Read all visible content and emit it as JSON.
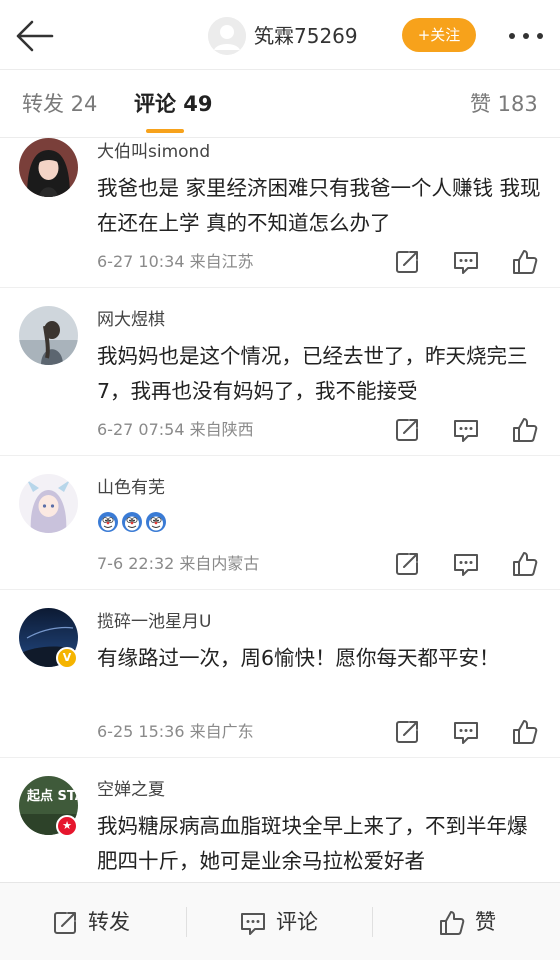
{
  "header": {
    "username": "笂霖75269",
    "follow_label": "+关注"
  },
  "tabs": {
    "reposts": "转发 24",
    "comments": "评论 49",
    "likes": "赞 183"
  },
  "comments": [
    {
      "name": "大伯叫simond",
      "text": "我爸也是 家里经济困难只有我爸一个人赚钱 我现在还在上学 真的不知道怎么办了",
      "meta": "6-27 10:34  来自江苏"
    },
    {
      "name": "网大煜棋",
      "text": "我妈妈也是这个情况，已经去世了，昨天烧完三7，我再也没有妈妈了，我不能接受",
      "meta": "6-27 07:54  来自陕西"
    },
    {
      "name": "山色有芜",
      "emoji_count": 3,
      "meta": "7-6 22:32  来自内蒙古"
    },
    {
      "name": "揽碎一池星月U",
      "text": "有缘路过一次，周6愉快！愿你每天都平安！",
      "meta": "6-25 15:36  来自广东"
    },
    {
      "name": "空婵之夏",
      "text": "我妈糖尿病高血脂斑块全早上来了，不到半年爆肥四十斤，她可是业余马拉松爱好者"
    }
  ],
  "avatar5_text": "起点 START",
  "bottom": {
    "repost": "转发",
    "comment": "评论",
    "like": "赞"
  },
  "colors": {
    "accent": "#f7a21b",
    "verified_gold": "#f5b400",
    "verified_red": "#e6162d"
  }
}
